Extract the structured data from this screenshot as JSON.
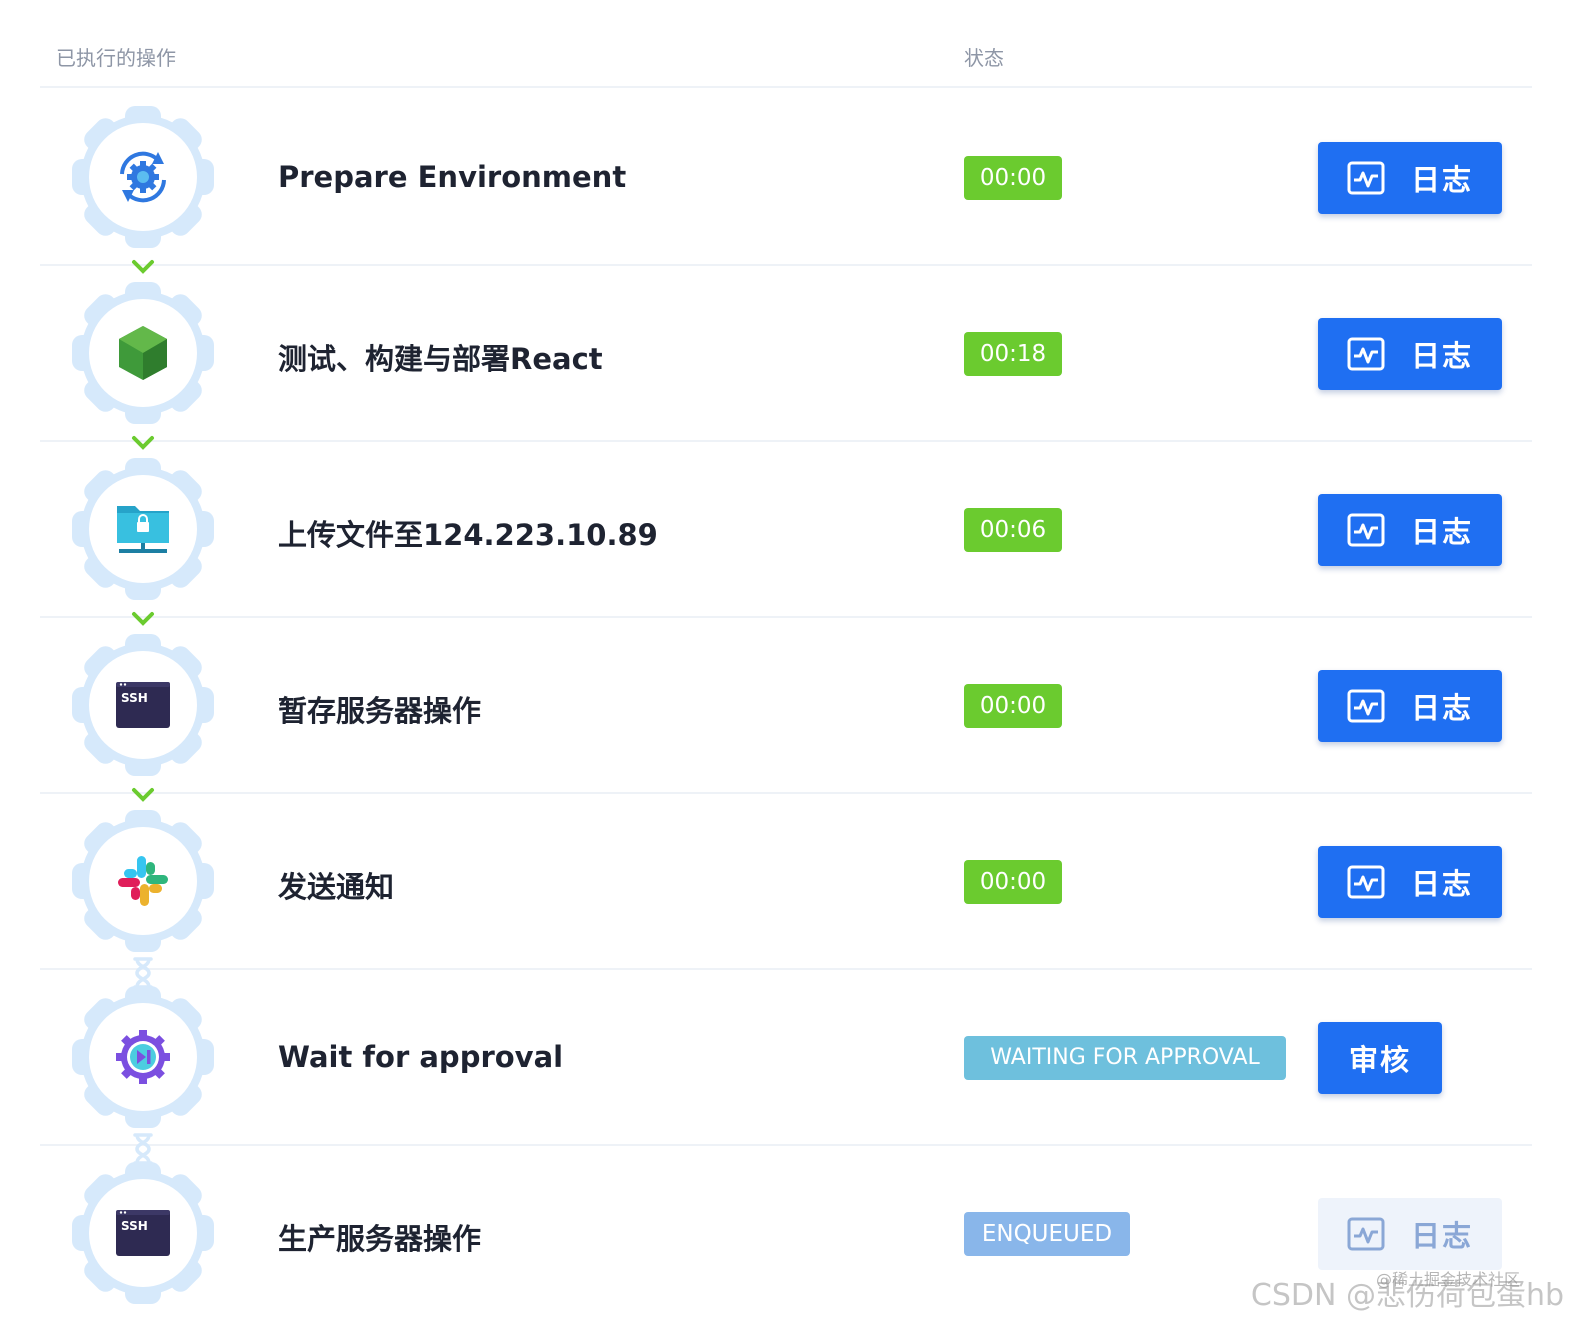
{
  "header": {
    "operations_title": "已执行的操作",
    "status_title": "状态"
  },
  "rows": [
    {
      "name": "Prepare Environment",
      "status": "00:00",
      "status_type": "success",
      "action": "日志",
      "icon": "gear-sync-icon"
    },
    {
      "name": "测试、构建与部署React",
      "status": "00:18",
      "status_type": "success",
      "action": "日志",
      "icon": "nodejs-hexagon-icon"
    },
    {
      "name": "上传文件至124.223.10.89",
      "status": "00:06",
      "status_type": "success",
      "action": "日志",
      "icon": "folder-lock-network-icon"
    },
    {
      "name": "暂存服务器操作",
      "status": "00:00",
      "status_type": "success",
      "action": "日志",
      "icon": "ssh-terminal-icon",
      "icon_text": "SSH"
    },
    {
      "name": "发送通知",
      "status": "00:00",
      "status_type": "success",
      "action": "日志",
      "icon": "slack-icon"
    },
    {
      "name": "Wait for approval",
      "status": "WAITING FOR APPROVAL",
      "status_type": "waiting",
      "action": "审核",
      "icon": "approval-gear-icon"
    },
    {
      "name": "生产服务器操作",
      "status": "ENQUEUED",
      "status_type": "queued",
      "action": "日志",
      "icon": "ssh-terminal-icon",
      "icon_text": "SSH"
    }
  ],
  "colors": {
    "success": "#6bcb2f",
    "waiting": "#6ec0dd",
    "queued": "#89b6ea",
    "primary": "#1f6ff2"
  },
  "watermark": {
    "main": "CSDN @悲伤荷包蛋hb",
    "sub": "@稀土掘金技术社区"
  }
}
